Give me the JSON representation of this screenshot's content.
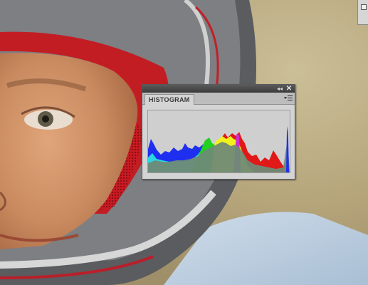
{
  "panel": {
    "tab_label": "HISTOGRAM"
  },
  "colors": {
    "panel_bg": "#d4d4d4",
    "titlebar": "#3b3b3b",
    "gray_luminosity": "#6f8a76",
    "red": "#e01818",
    "green": "#22d11f",
    "blue": "#1f2ff0",
    "yellow": "#f2f21a",
    "cyan": "#2ad7df",
    "magenta": "#d02bd0"
  },
  "icons": {
    "collapse": "double-chevron-left-icon",
    "close": "close-icon",
    "panel_menu": "panel-menu-icon"
  }
}
